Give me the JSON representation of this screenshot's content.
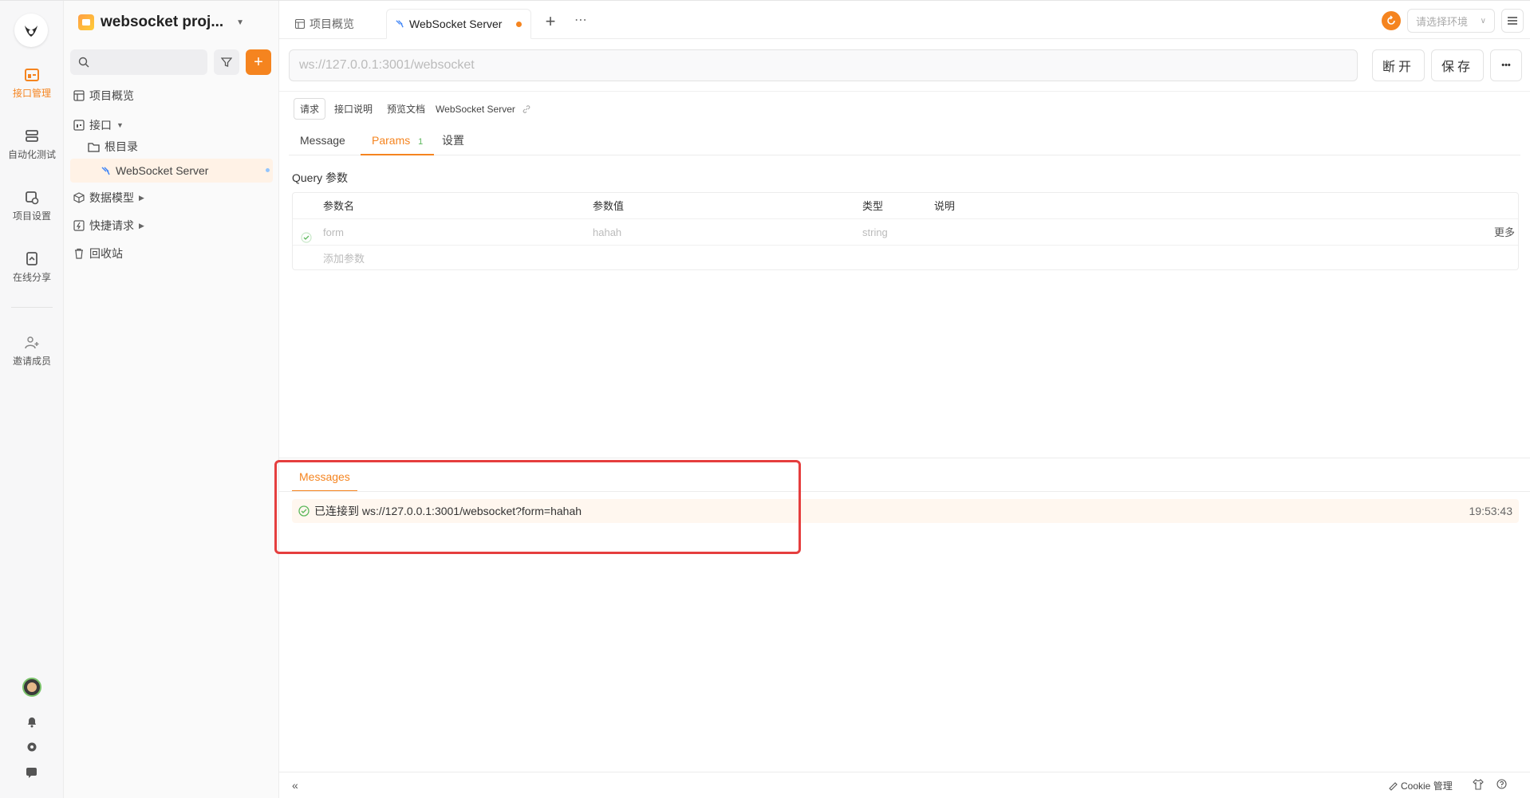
{
  "rail": {
    "items": [
      {
        "label": "接口管理",
        "icon": "api-management-icon"
      },
      {
        "label": "自动化测试",
        "icon": "automation-test-icon"
      },
      {
        "label": "项目设置",
        "icon": "project-settings-icon"
      },
      {
        "label": "在线分享",
        "icon": "online-share-icon"
      },
      {
        "label": "邀请成员",
        "icon": "invite-member-icon"
      }
    ]
  },
  "sidebar": {
    "project_name": "websocket proj...",
    "items": [
      {
        "label": "项目概览"
      },
      {
        "label": "接口"
      },
      {
        "label": "根目录"
      },
      {
        "label": "WebSocket Server"
      },
      {
        "label": "数据模型"
      },
      {
        "label": "快捷请求"
      },
      {
        "label": "回收站"
      }
    ]
  },
  "tabs": [
    {
      "label": "项目概览"
    },
    {
      "label": "WebSocket Server"
    }
  ],
  "env": {
    "placeholder": "请选择环境"
  },
  "request": {
    "url": "ws://127.0.0.1:3001/websocket",
    "disconnect_label": "断开",
    "save_label": "保存",
    "more_label": "•••"
  },
  "sub_tabs": [
    {
      "label": "请求"
    },
    {
      "label": "接口说明"
    },
    {
      "label": "预览文档"
    }
  ],
  "breadcrumb_name": "WebSocket Server",
  "param_tabs": {
    "message": "Message",
    "params": "Params",
    "params_count": "1",
    "settings": "设置"
  },
  "query": {
    "title": "Query 参数",
    "headers": [
      "参数名",
      "参数值",
      "类型",
      "说明"
    ],
    "rows": [
      {
        "name": "form",
        "value": "hahah",
        "type": "string",
        "more": "更多"
      }
    ],
    "add_placeholder": "添加参数"
  },
  "messages": {
    "tab_label": "Messages",
    "entries": [
      {
        "text": "已连接到 ws://127.0.0.1:3001/websocket?form=hahah",
        "time": "19:53:43"
      }
    ]
  },
  "footer": {
    "cookie_label": "Cookie 管理"
  },
  "colors": {
    "accent": "#f5841f",
    "highlight": "#e53e3e",
    "success": "#5cb85c"
  }
}
